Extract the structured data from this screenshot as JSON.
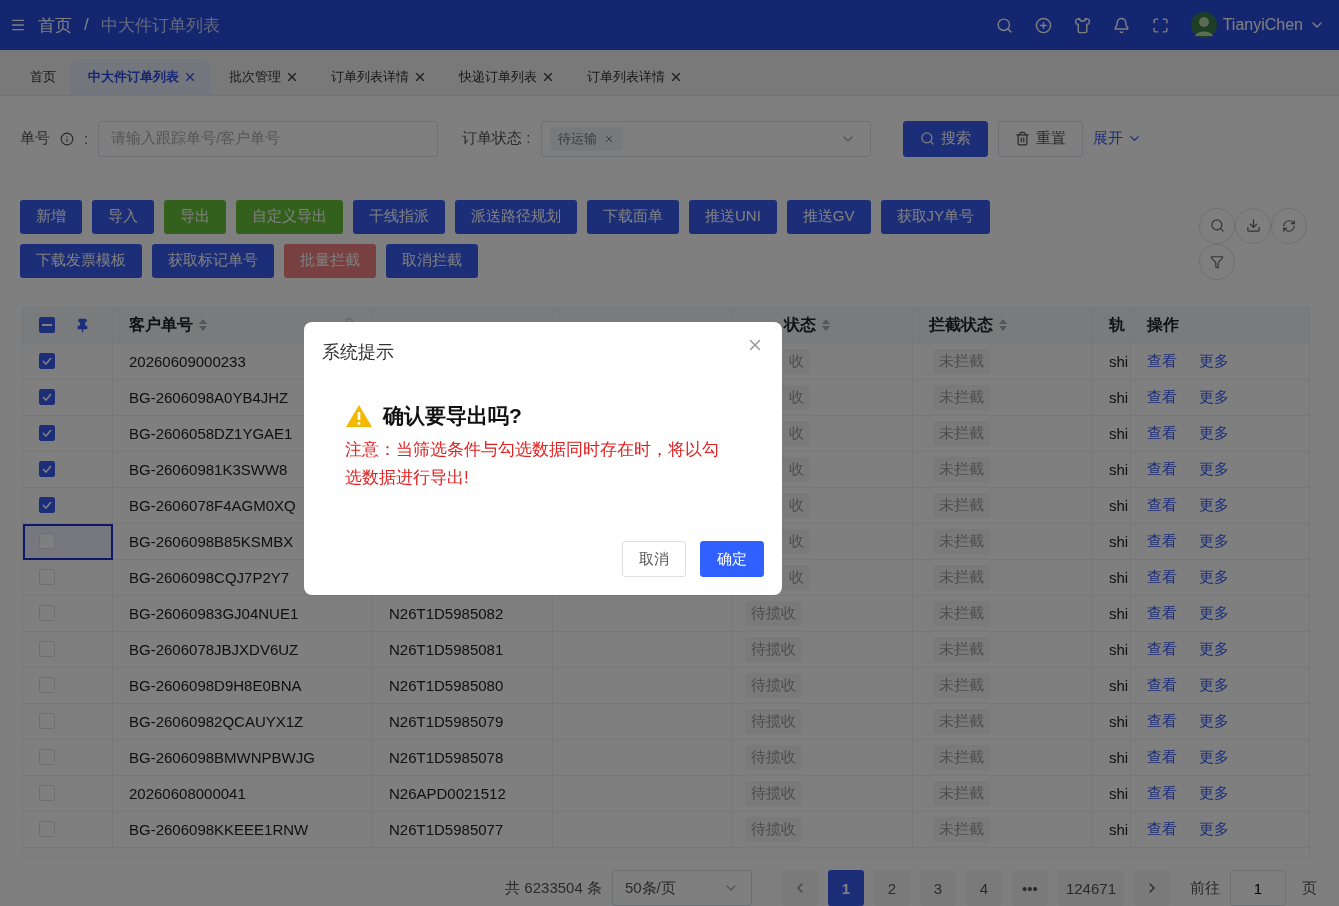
{
  "header": {
    "breadcrumb": [
      "首页",
      "/",
      "中大件订单列表"
    ],
    "user": "TianyiChen"
  },
  "tabs": [
    {
      "label": "首页",
      "selected": false,
      "closable": false
    },
    {
      "label": "中大件订单列表",
      "selected": true,
      "closable": true
    },
    {
      "label": "批次管理",
      "selected": false,
      "closable": true
    },
    {
      "label": "订单列表详情",
      "selected": false,
      "closable": true
    },
    {
      "label": "快递订单列表",
      "selected": false,
      "closable": true
    },
    {
      "label": "订单列表详情",
      "selected": false,
      "closable": true
    }
  ],
  "filters": {
    "number_label": "单号",
    "number_colon": ":",
    "number_placeholder": "请输入跟踪单号/客户单号",
    "status_label": "订单状态 :",
    "status_tag": "待运输",
    "search": "搜索",
    "reset": "重置",
    "expand": "展开"
  },
  "actions": [
    {
      "label": "新增",
      "kind": "primary"
    },
    {
      "label": "导入",
      "kind": "primary"
    },
    {
      "label": "导出",
      "kind": "success"
    },
    {
      "label": "自定义导出",
      "kind": "success"
    },
    {
      "label": "干线指派",
      "kind": "primary"
    },
    {
      "label": "派送路径规划",
      "kind": "primary"
    },
    {
      "label": "下载面单",
      "kind": "primary"
    },
    {
      "label": "推送UNI",
      "kind": "primary"
    },
    {
      "label": "推送GV",
      "kind": "primary"
    },
    {
      "label": "获取JY单号",
      "kind": "primary"
    },
    {
      "label": "下载发票模板",
      "kind": "primary"
    },
    {
      "label": "获取标记单号",
      "kind": "primary"
    },
    {
      "label": "批量拦截",
      "kind": "danger"
    },
    {
      "label": "取消拦截",
      "kind": "primary"
    }
  ],
  "table": {
    "select_all": {
      "indeterminate": true
    },
    "columns": [
      {
        "label": "客户单号",
        "sortable": true,
        "fixed": true
      },
      {
        "label": "状态",
        "sortable": true,
        "covered": true
      },
      {
        "label": "拦截状态",
        "sortable": true
      },
      {
        "label": "轨"
      },
      {
        "label": "操作"
      }
    ],
    "rows": [
      {
        "checked": true,
        "focused": false,
        "covered": true,
        "customer_no": "20260609000233",
        "order_status": "收",
        "intercept": "未拦截",
        "track": "shi",
        "view": "查看",
        "more": "更多"
      },
      {
        "checked": true,
        "focused": false,
        "covered": true,
        "customer_no": "BG-2606098A0YB4JHZ",
        "order_status": "收",
        "intercept": "未拦截",
        "track": "shi",
        "view": "查看",
        "more": "更多"
      },
      {
        "checked": true,
        "focused": false,
        "covered": true,
        "customer_no": "BG-2606058DZ1YGAE1",
        "order_status": "收",
        "intercept": "未拦截",
        "track": "shi",
        "view": "查看",
        "more": "更多"
      },
      {
        "checked": true,
        "focused": false,
        "covered": true,
        "customer_no": "BG-26060981K3SWW8",
        "order_status": "收",
        "intercept": "未拦截",
        "track": "shi",
        "view": "查看",
        "more": "更多"
      },
      {
        "checked": true,
        "focused": false,
        "covered": true,
        "customer_no": "BG-2606078F4AGM0XQ",
        "order_status": "收",
        "intercept": "未拦截",
        "track": "shi",
        "view": "查看",
        "more": "更多"
      },
      {
        "checked": false,
        "focused": true,
        "covered": true,
        "customer_no": "BG-2606098B85KSMBX",
        "order_status": "收",
        "intercept": "未拦截",
        "track": "shi",
        "view": "查看",
        "more": "更多"
      },
      {
        "checked": false,
        "focused": false,
        "covered": true,
        "customer_no": "BG-2606098CQJ7P2Y7",
        "order_status": "收",
        "intercept": "未拦截",
        "track": "shi",
        "view": "查看",
        "more": "更多"
      },
      {
        "checked": false,
        "focused": false,
        "covered": false,
        "customer_no": "BG-26060983GJ04NUE1",
        "tracking_no": "N26T1D5985082",
        "order_status": "待揽收",
        "intercept": "未拦截",
        "track": "shi",
        "view": "查看",
        "more": "更多"
      },
      {
        "checked": false,
        "focused": false,
        "covered": false,
        "customer_no": "BG-2606078JBJXDV6UZ",
        "tracking_no": "N26T1D5985081",
        "order_status": "待揽收",
        "intercept": "未拦截",
        "track": "shi",
        "view": "查看",
        "more": "更多"
      },
      {
        "checked": false,
        "focused": false,
        "covered": false,
        "customer_no": "BG-2606098D9H8E0BNA",
        "tracking_no": "N26T1D5985080",
        "order_status": "待揽收",
        "intercept": "未拦截",
        "track": "shi",
        "view": "查看",
        "more": "更多"
      },
      {
        "checked": false,
        "focused": false,
        "covered": false,
        "customer_no": "BG-26060982QCAUYX1Z",
        "tracking_no": "N26T1D5985079",
        "order_status": "待揽收",
        "intercept": "未拦截",
        "track": "shi",
        "view": "查看",
        "more": "更多"
      },
      {
        "checked": false,
        "focused": false,
        "covered": false,
        "customer_no": "BG-2606098BMWNPBWJG",
        "tracking_no": "N26T1D5985078",
        "order_status": "待揽收",
        "intercept": "未拦截",
        "track": "shi",
        "view": "查看",
        "more": "更多"
      },
      {
        "checked": false,
        "focused": false,
        "covered": false,
        "customer_no": "20260608000041",
        "tracking_no": "N26APD0021512",
        "order_status": "待揽收",
        "intercept": "未拦截",
        "track": "shi",
        "view": "查看",
        "more": "更多"
      },
      {
        "checked": false,
        "focused": false,
        "covered": false,
        "customer_no": "BG-2606098KKEEE1RNW",
        "tracking_no": "N26T1D5985077",
        "order_status": "待揽收",
        "intercept": "未拦截",
        "track": "shi",
        "view": "查看",
        "more": "更多"
      }
    ]
  },
  "pagination": {
    "total": "共 6233504 条",
    "page_size": "50条/页",
    "pages": [
      {
        "label": "1",
        "selected": true
      },
      {
        "label": "2",
        "selected": false
      },
      {
        "label": "3",
        "selected": false
      },
      {
        "label": "4",
        "selected": false
      },
      {
        "label": "•••",
        "selected": false
      },
      {
        "label": "124671",
        "selected": false
      }
    ],
    "goto": "前往",
    "goto_value": "1",
    "page_unit": "页"
  },
  "dialog": {
    "title": "系统提示",
    "heading": "确认要导出吗?",
    "message": "注意：当筛选条件与勾选数据同时存在时，将以勾选数据进行导出!",
    "cancel": "取消",
    "confirm": "确定"
  }
}
